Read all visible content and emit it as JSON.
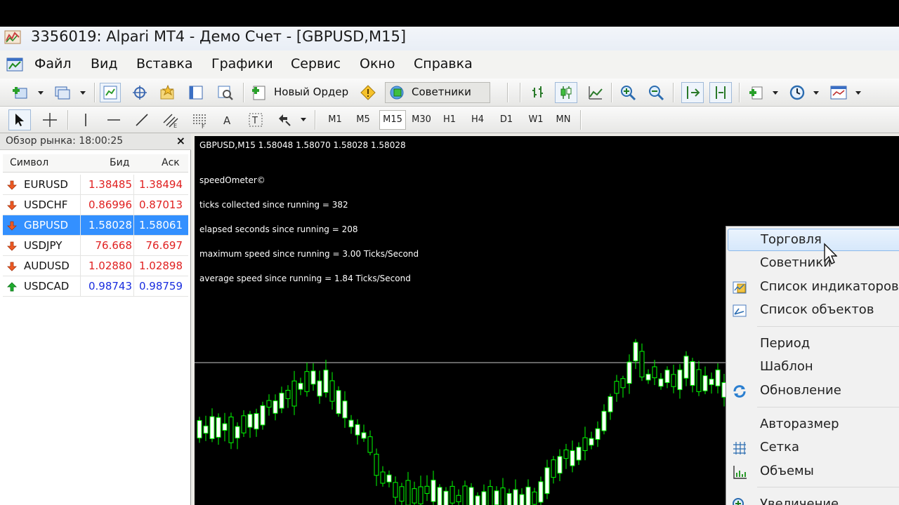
{
  "window": {
    "title": "3356019: Alpari MT4 - Демо Счет - [GBPUSD,M15]"
  },
  "menu": [
    "Файл",
    "Вид",
    "Вставка",
    "Графики",
    "Сервис",
    "Окно",
    "Справка"
  ],
  "toolbar": {
    "new_order_label": "Новый Ордер",
    "experts_label": "Советники",
    "timeframes": [
      "M1",
      "M5",
      "M15",
      "M30",
      "H1",
      "H4",
      "D1",
      "W1",
      "MN"
    ],
    "active_timeframe": "M15"
  },
  "market_watch": {
    "title": "Обзор рынка: 18:00:25",
    "close_glyph": "×",
    "columns": {
      "symbol": "Символ",
      "bid": "Бид",
      "ask": "Аск"
    },
    "rows": [
      {
        "symbol": "EURUSD",
        "bid": "1.38485",
        "ask": "1.38494",
        "direction": "down"
      },
      {
        "symbol": "USDCHF",
        "bid": "0.86996",
        "ask": "0.87013",
        "direction": "down"
      },
      {
        "symbol": "GBPUSD",
        "bid": "1.58028",
        "ask": "1.58061",
        "direction": "down",
        "selected": true
      },
      {
        "symbol": "USDJPY",
        "bid": "76.668",
        "ask": "76.697",
        "direction": "down"
      },
      {
        "symbol": "AUDUSD",
        "bid": "1.02880",
        "ask": "1.02898",
        "direction": "down"
      },
      {
        "symbol": "USDCAD",
        "bid": "0.98743",
        "ask": "0.98759",
        "direction": "up"
      }
    ]
  },
  "chart": {
    "header": "GBPUSD,M15  1.58048 1.58070 1.58028 1.58028",
    "indicator_lines": [
      "speedOmeter©",
      "ticks collected since running = 382",
      "elapsed seconds since running = 208",
      "maximum speed since running = 3.00 Ticks/Second",
      "average speed since running = 1.84 Ticks/Second"
    ]
  },
  "context_menu": {
    "items": [
      {
        "label": "Торговля",
        "icon": "none",
        "highlighted": true
      },
      {
        "label": "Советники",
        "icon": "none"
      },
      {
        "label": "Список индикаторов",
        "icon": "indicator-list-icon"
      },
      {
        "label": "Список объектов",
        "icon": "objects-list-icon"
      },
      {
        "label": "Период",
        "icon": "none"
      },
      {
        "label": "Шаблон",
        "icon": "none"
      },
      {
        "label": "Обновление",
        "icon": "refresh-icon"
      },
      {
        "label": "Авторазмер",
        "icon": "none"
      },
      {
        "label": "Сетка",
        "icon": "grid-icon"
      },
      {
        "label": "Объемы",
        "icon": "volumes-icon"
      },
      {
        "label": "Увеличение",
        "icon": "zoom-in-icon"
      }
    ]
  },
  "colors": {
    "bid_red": "#e02020",
    "ask_blue": "#1a2ddf",
    "selection": "#3390ff",
    "candle_green": "#00ff00"
  }
}
